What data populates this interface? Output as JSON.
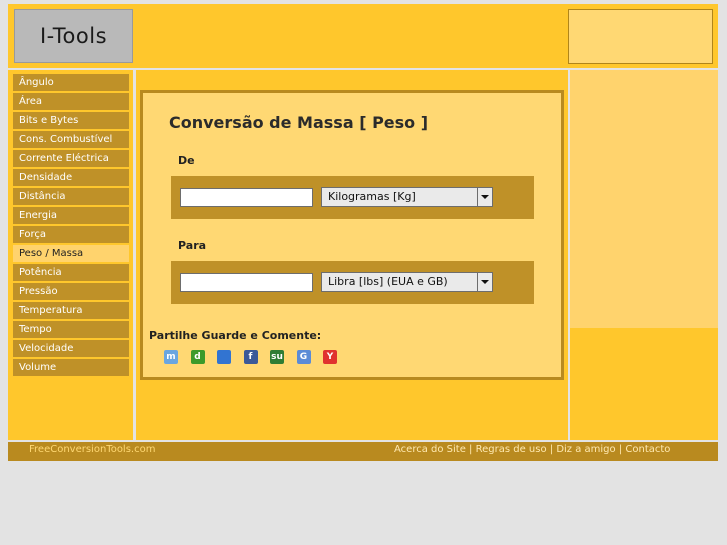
{
  "logo": {
    "text": "I-Tools"
  },
  "sidebar": {
    "items": [
      {
        "label": "Ângulo"
      },
      {
        "label": "Área"
      },
      {
        "label": "Bits e Bytes"
      },
      {
        "label": "Cons. Combustível"
      },
      {
        "label": "Corrente Eléctrica"
      },
      {
        "label": "Densidade"
      },
      {
        "label": "Distância"
      },
      {
        "label": "Energia"
      },
      {
        "label": "Força"
      },
      {
        "label": "Peso / Massa"
      },
      {
        "label": "Potência"
      },
      {
        "label": "Pressão"
      },
      {
        "label": "Temperatura"
      },
      {
        "label": "Tempo"
      },
      {
        "label": "Velocidade"
      },
      {
        "label": "Volume"
      }
    ],
    "active_label": "Peso / Massa"
  },
  "converter": {
    "title": "Conversão de Massa [ Peso ]",
    "from": {
      "label": "De",
      "value": "",
      "unit": "Kilogramas [Kg]"
    },
    "to": {
      "label": "Para",
      "value": "",
      "unit": "Libra [lbs] (EUA e GB)"
    }
  },
  "share": {
    "label": "Partilhe Guarde e Comente:",
    "icons": [
      {
        "name": "meneame-icon",
        "glyph": "m",
        "color": "#6aa6e0"
      },
      {
        "name": "digg-icon",
        "glyph": "d",
        "color": "#3c9a2a"
      },
      {
        "name": "delicious-icon",
        "glyph": "",
        "color": "#3274d1"
      },
      {
        "name": "facebook-icon",
        "glyph": "f",
        "color": "#3b5998"
      },
      {
        "name": "stumbleupon-icon",
        "glyph": "su",
        "color": "#2f7d34"
      },
      {
        "name": "google-icon",
        "glyph": "G",
        "color": "#5b8bd6"
      },
      {
        "name": "yahoo-icon",
        "glyph": "Y",
        "color": "#e0322e"
      }
    ]
  },
  "footer": {
    "site": "FreeConversionTools.com",
    "links": [
      "Acerca do Site",
      "Regras de uso",
      "Diz a amigo",
      "Contacto"
    ],
    "separator": " | "
  },
  "colors": {
    "accent": "#ffc72c",
    "nav": "#bf9128",
    "panel": "#ffd873",
    "footer": "#b98a1f"
  }
}
